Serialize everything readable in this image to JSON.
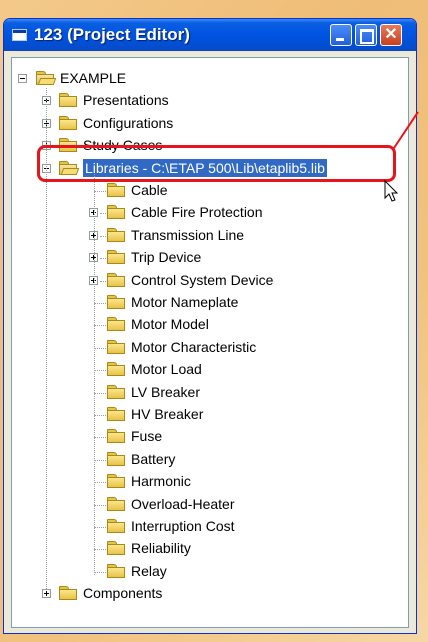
{
  "window": {
    "title": "123 (Project Editor)",
    "controls": {
      "minimize": "minimize",
      "maximize": "maximize",
      "close": "✕"
    }
  },
  "tree": {
    "root": "EXAMPLE",
    "top_nodes": [
      {
        "label": "Presentations",
        "expander": "plus"
      },
      {
        "label": "Configurations",
        "expander": "plus"
      },
      {
        "label": "Study Cases",
        "expander": "plus"
      },
      {
        "label": "Libraries - C:\\ETAP 500\\Lib\\etaplib5.lib",
        "expander": "minus",
        "selected": true
      }
    ],
    "library_children": [
      {
        "label": "Cable",
        "expander": "none"
      },
      {
        "label": "Cable Fire Protection",
        "expander": "plus"
      },
      {
        "label": "Transmission Line",
        "expander": "plus"
      },
      {
        "label": "Trip Device",
        "expander": "plus"
      },
      {
        "label": "Control System Device",
        "expander": "plus"
      },
      {
        "label": "Motor Nameplate",
        "expander": "none"
      },
      {
        "label": "Motor Model",
        "expander": "none"
      },
      {
        "label": "Motor Characteristic",
        "expander": "none"
      },
      {
        "label": "Motor Load",
        "expander": "none"
      },
      {
        "label": "LV Breaker",
        "expander": "none"
      },
      {
        "label": "HV Breaker",
        "expander": "none"
      },
      {
        "label": "Fuse",
        "expander": "none"
      },
      {
        "label": "Battery",
        "expander": "none"
      },
      {
        "label": "Harmonic",
        "expander": "none"
      },
      {
        "label": "Overload-Heater",
        "expander": "none"
      },
      {
        "label": "Interruption Cost",
        "expander": "none"
      },
      {
        "label": "Reliability",
        "expander": "none"
      },
      {
        "label": "Relay",
        "expander": "none"
      }
    ],
    "bottom_nodes": [
      {
        "label": "Components",
        "expander": "plus"
      }
    ]
  },
  "colors": {
    "highlight_box": "#e8141b",
    "selection": "#316ac5",
    "titlebar": "#0054e3"
  }
}
